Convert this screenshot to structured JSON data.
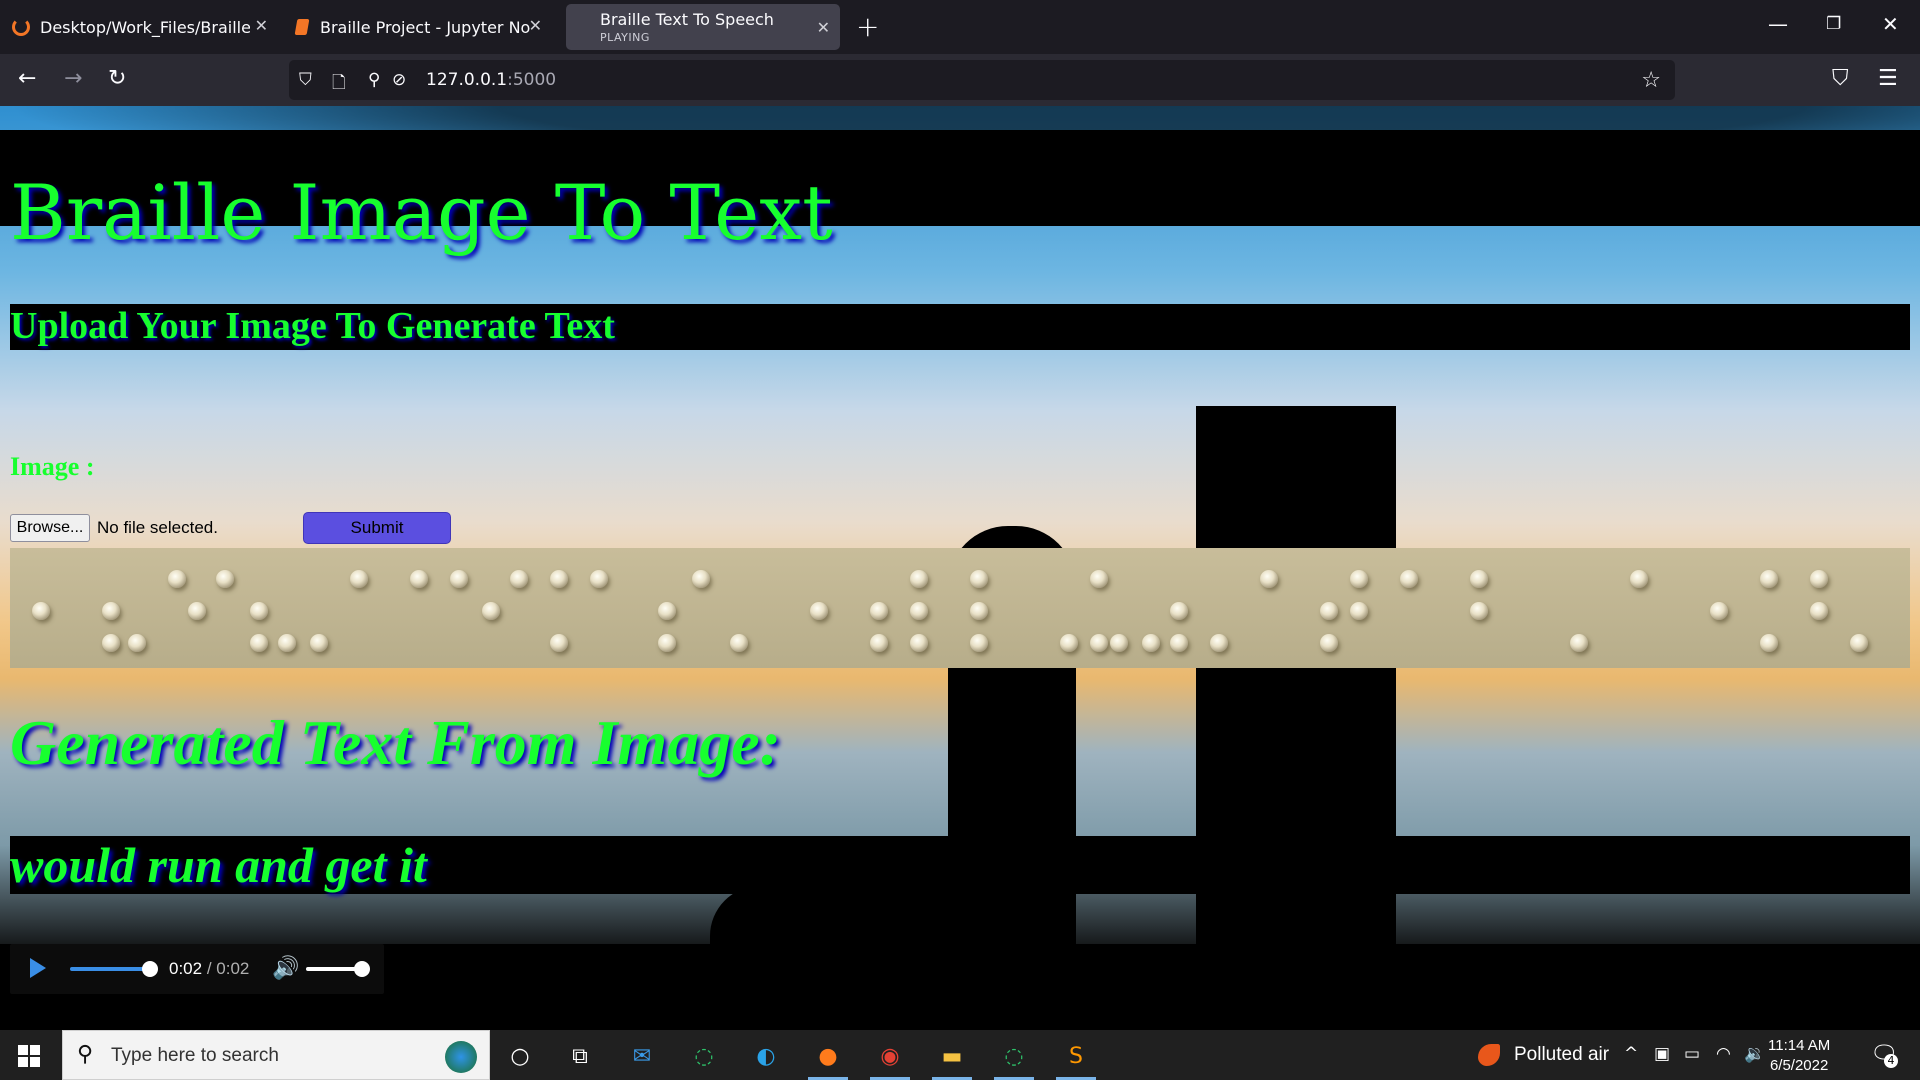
{
  "browser": {
    "tabs": [
      {
        "title": "Desktop/Work_Files/Braille Proj",
        "icon": "jupyter-icon"
      },
      {
        "title": "Braille Project - Jupyter Notebo",
        "icon": "notebook-icon"
      },
      {
        "title": "Braille Text To Speech",
        "subtitle": "PLAYING",
        "active": true
      }
    ],
    "url_host": "127.0.0.1",
    "url_port": ":5000"
  },
  "page": {
    "title": "Braille Image To Text",
    "subtitle": "Upload Your Image To Generate Text",
    "image_label": "Image :",
    "browse_label": "Browse...",
    "file_status": "No file selected.",
    "submit_label": "Submit",
    "generated_heading": "Generated Text From Image:",
    "generated_text": "would run and get it",
    "audio": {
      "current_time": "0:02",
      "separator": " / ",
      "duration": "0:02",
      "progress": 1.0,
      "volume": 1.0
    },
    "colors": {
      "heading": "#17ff2e",
      "heading_shadow": "#0000b5",
      "submit": "#5b4fe0"
    }
  },
  "taskbar": {
    "search_placeholder": "Type here to search",
    "weather": "Polluted air",
    "time": "11:14 AM",
    "date": "6/5/2022",
    "notifications": "4",
    "apps": [
      "task-view-icon",
      "cortana-icon",
      "mail-icon",
      "app-icon",
      "edge-icon",
      "firefox-icon",
      "chrome-icon",
      "file-explorer-icon",
      "jupyter-icon",
      "sublime-text-icon"
    ]
  }
}
